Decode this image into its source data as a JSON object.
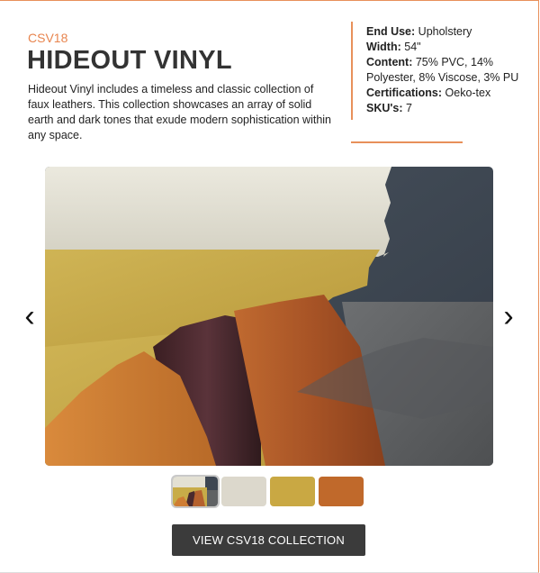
{
  "product": {
    "code": "CSV18",
    "name": "HIDEOUT VINYL",
    "description": "Hideout Vinyl includes a timeless and classic collection of faux leathers. This collection showcases an array of solid earth and dark tones that exude modern sophistication within any space."
  },
  "specs": [
    {
      "label": "End Use:",
      "value": " Upholstery"
    },
    {
      "label": "Width:",
      "value": " 54\""
    },
    {
      "label": "Content:",
      "value": " 75% PVC, 14% Polyester, 8% Viscose, 3% PU"
    },
    {
      "label": "Certifications:",
      "value": " Oeko-tex"
    },
    {
      "label": "SKU's:",
      "value": " 7"
    }
  ],
  "carousel": {
    "prev_icon": "chevron-left-icon",
    "next_icon": "chevron-right-icon",
    "prev_glyph": "‹",
    "next_glyph": "›",
    "active_index": 0,
    "swatch_colors": {
      "cream": "#e3e0d3",
      "mustard": "#c8ac48",
      "navy": "#3d4652",
      "burgundy": "#4a2a2e",
      "rust": "#b5612e",
      "orange": "#cf7d33",
      "charcoal": "#606264"
    },
    "thumbnails": [
      {
        "name": "collection-overview",
        "color": "#5a5048"
      },
      {
        "name": "cream",
        "color": "#dcd8cc"
      },
      {
        "name": "mustard",
        "color": "#c9a843"
      },
      {
        "name": "rust",
        "color": "#c0692b"
      }
    ]
  },
  "cta": {
    "label": "VIEW CSV18 COLLECTION"
  },
  "colors": {
    "accent": "#e8854f",
    "button_bg": "#3b3b3b"
  }
}
